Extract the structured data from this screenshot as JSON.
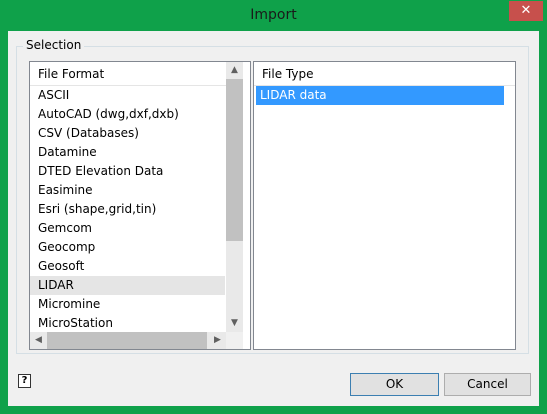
{
  "window": {
    "title": "Import",
    "close_glyph": "✕"
  },
  "selection": {
    "label": "Selection",
    "file_format": {
      "header": "File Format",
      "items": [
        "ASCII",
        "AutoCAD (dwg,dxf,dxb)",
        "CSV (Databases)",
        "Datamine",
        "DTED Elevation Data",
        "Easimine",
        "Esri (shape,grid,tin)",
        "Gemcom",
        "Geocomp",
        "Geosoft",
        "LIDAR",
        "Micromine",
        "MicroStation"
      ],
      "highlighted": "LIDAR"
    },
    "file_type": {
      "header": "File Type",
      "items": [
        "LIDAR data"
      ],
      "selected": "LIDAR data"
    }
  },
  "help_icon": "?",
  "buttons": {
    "ok": "OK",
    "cancel": "Cancel"
  }
}
